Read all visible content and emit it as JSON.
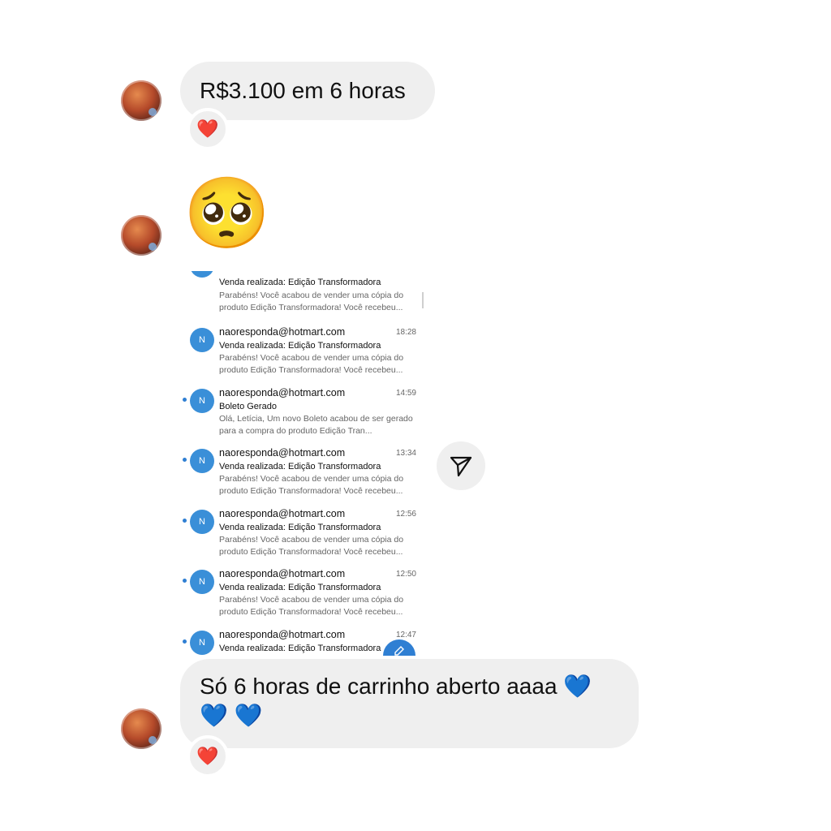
{
  "messages": {
    "first": {
      "text": "R$3.100 em 6 horas",
      "reaction": "❤️"
    },
    "second": {
      "emoji": "🥺"
    },
    "last": {
      "line1": "Só 6 horas de carrinho aberto aaaa 💙",
      "line2": "💙 💙",
      "reaction": "❤️"
    }
  },
  "inbox": {
    "partial_top": {
      "subject": "Venda realizada: Edição Transformadora",
      "preview": "Parabéns! Você acabou de vender uma cópia do produto Edição Transformadora! Você recebeu..."
    },
    "rows": [
      {
        "avatar": "N",
        "from": "naoresponda@hotmart.com",
        "time": "18:28",
        "subject": "Venda realizada: Edição Transformadora",
        "preview": "Parabéns! Você acabou de vender uma cópia do produto Edição Transformadora! Você recebeu..."
      },
      {
        "avatar": "N",
        "from": "naoresponda@hotmart.com",
        "time": "14:59",
        "subject": "Boleto Gerado",
        "preview": "Olá, Letícia, Um novo Boleto acabou de ser gerado para a compra do produto Edição Tran..."
      },
      {
        "avatar": "N",
        "from": "naoresponda@hotmart.com",
        "time": "13:34",
        "subject": "Venda realizada: Edição Transformadora",
        "preview": "Parabéns! Você acabou de vender uma cópia do produto Edição Transformadora! Você recebeu..."
      },
      {
        "avatar": "N",
        "from": "naoresponda@hotmart.com",
        "time": "12:56",
        "subject": "Venda realizada: Edição Transformadora",
        "preview": "Parabéns! Você acabou de vender uma cópia do produto Edição Transformadora! Você recebeu..."
      },
      {
        "avatar": "N",
        "from": "naoresponda@hotmart.com",
        "time": "12:50",
        "subject": "Venda realizada: Edição Transformadora",
        "preview": "Parabéns! Você acabou de vender uma cópia do produto Edição Transformadora! Você recebeu..."
      },
      {
        "avatar": "N",
        "from": "naoresponda@hotmart.com",
        "time": "12:47",
        "subject": "Venda realizada: Edição Transformadora",
        "preview": ""
      }
    ],
    "compose_icon": "compose-icon"
  },
  "share": {
    "icon": "send-icon"
  },
  "colors": {
    "bubble": "#efefef",
    "accent": "#2f7fd3"
  }
}
